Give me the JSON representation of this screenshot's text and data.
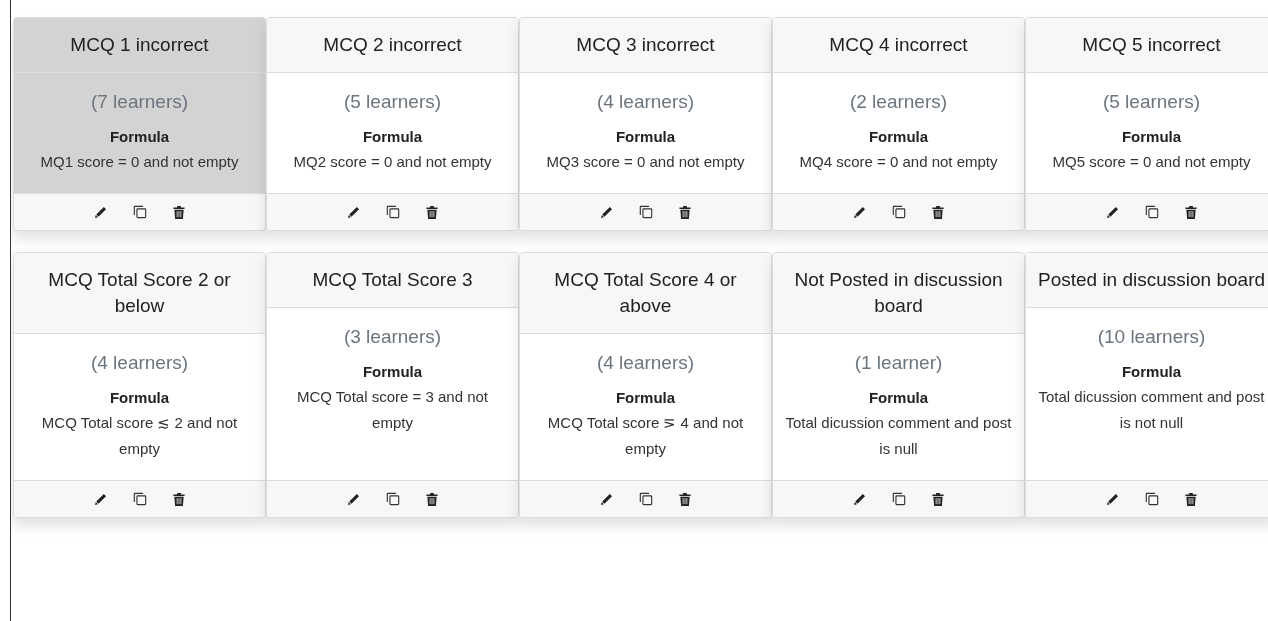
{
  "cards": [
    {
      "title": "MCQ 1 incorrect",
      "learners": "(7 learners)",
      "formula_label": "Formula",
      "formula": "MQ1 score = 0 and not empty",
      "selected": true
    },
    {
      "title": "MCQ 2 incorrect",
      "learners": "(5 learners)",
      "formula_label": "Formula",
      "formula": "MQ2 score = 0 and not empty",
      "selected": false
    },
    {
      "title": "MCQ 3 incorrect",
      "learners": "(4 learners)",
      "formula_label": "Formula",
      "formula": "MQ3 score = 0 and not empty",
      "selected": false
    },
    {
      "title": "MCQ 4 incorrect",
      "learners": "(2 learners)",
      "formula_label": "Formula",
      "formula": "MQ4 score = 0 and not empty",
      "selected": false
    },
    {
      "title": "MCQ 5 incorrect",
      "learners": "(5 learners)",
      "formula_label": "Formula",
      "formula": "MQ5 score = 0 and not empty",
      "selected": false
    },
    {
      "title": "MCQ Total Score 2 or below",
      "learners": "(4 learners)",
      "formula_label": "Formula",
      "formula": "MCQ Total score ≲ 2 and not empty",
      "selected": false
    },
    {
      "title": "MCQ Total Score 3",
      "learners": "(3 learners)",
      "formula_label": "Formula",
      "formula": "MCQ Total score = 3 and not empty",
      "selected": false
    },
    {
      "title": "MCQ Total Score 4 or above",
      "learners": "(4 learners)",
      "formula_label": "Formula",
      "formula": "MCQ Total score ⋝ 4 and not empty",
      "selected": false
    },
    {
      "title": "Not Posted in discussion board",
      "learners": "(1 learner)",
      "formula_label": "Formula",
      "formula": "Total dicussion comment and post is null",
      "selected": false
    },
    {
      "title": "Posted in discussion board",
      "learners": "(10 learners)",
      "formula_label": "Formula",
      "formula": "Total dicussion comment and post is not null",
      "selected": false
    }
  ]
}
